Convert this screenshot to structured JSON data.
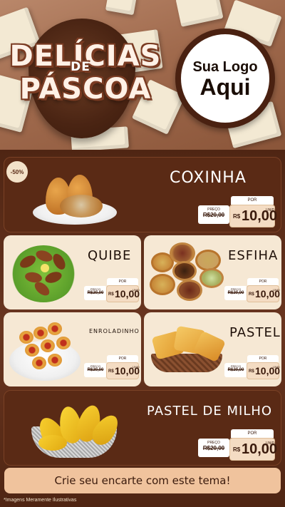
{
  "header": {
    "title_line1": "DELÍCIAS",
    "title_de": "DE",
    "title_line2": "PÁSCOA",
    "logo_line1": "Sua Logo",
    "logo_line2": "Aqui"
  },
  "badge": "-50%",
  "price_labels": {
    "old_label": "PREÇO",
    "por_label": "POR",
    "unit_label": "UNID"
  },
  "products": [
    {
      "name": "COXINHA",
      "old_price": "R$20,00",
      "currency": "R$",
      "new_price": "10,00"
    },
    {
      "name": "QUIBE",
      "old_price": "R$20,00",
      "currency": "R$",
      "new_price": "10,00"
    },
    {
      "name": "ESFIHA",
      "old_price": "R$20,00",
      "currency": "R$",
      "new_price": "10,00"
    },
    {
      "name": "ENROLADINHO",
      "old_price": "R$20,00",
      "currency": "R$",
      "new_price": "10,00"
    },
    {
      "name": "PASTEL",
      "old_price": "R$20,00",
      "currency": "R$",
      "new_price": "10,00"
    },
    {
      "name": "PASTEL DE MILHO",
      "old_price": "R$20,00",
      "currency": "R$",
      "new_price": "10,00"
    }
  ],
  "cta": "Crie seu encarte com este tema!",
  "footer_note": "*Imagens Meramente Ilustrativas",
  "colors": {
    "background": "#5a2c17",
    "card_dark": "#5a2a15",
    "card_light": "#f6e8d4",
    "price_box": "#f4dcc3",
    "cta": "#f0c39d"
  }
}
